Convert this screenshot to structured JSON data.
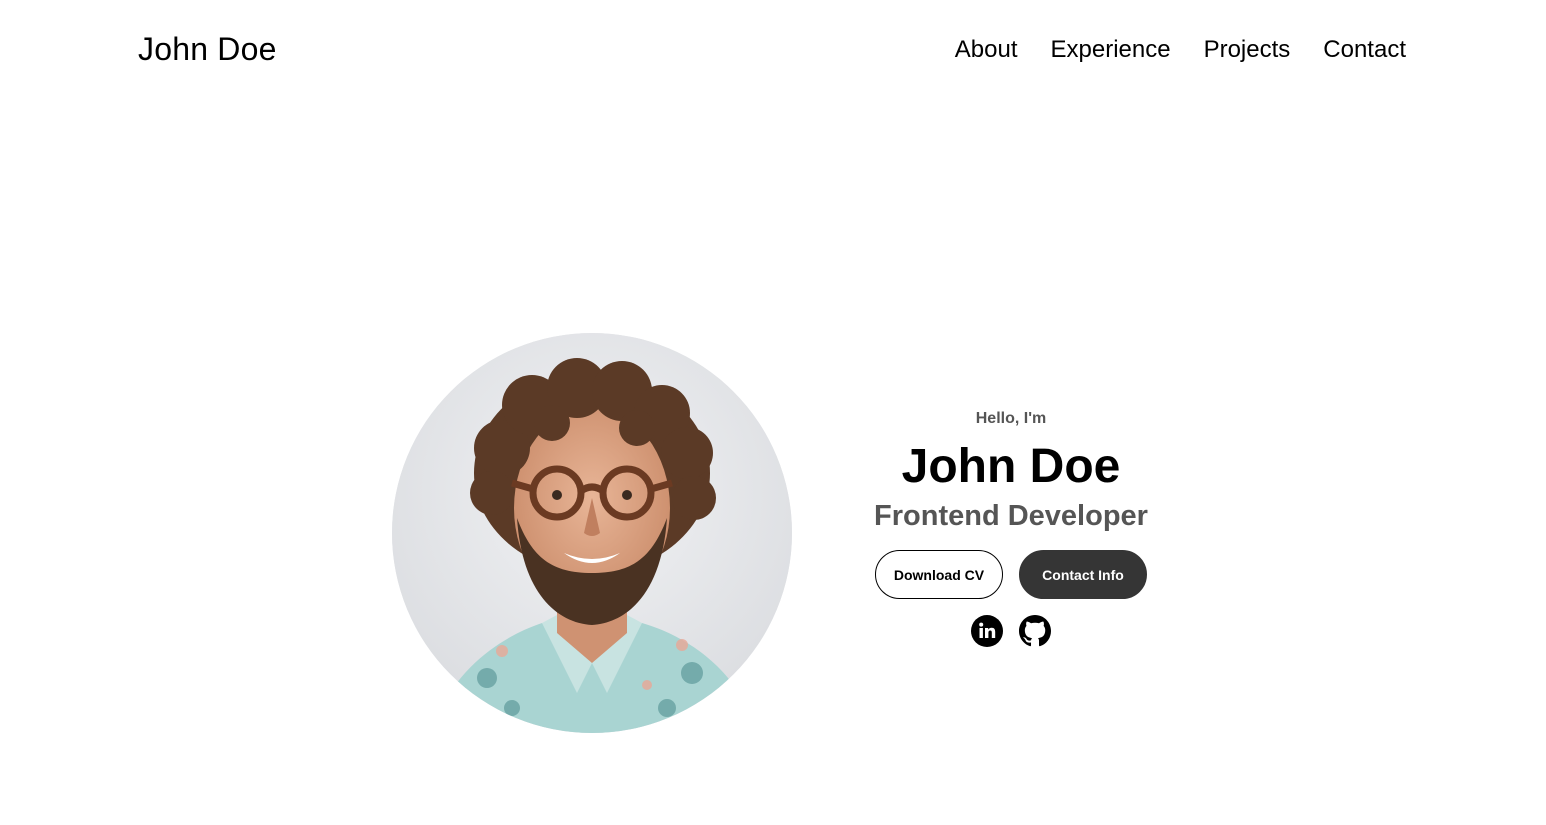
{
  "nav": {
    "logo": "John Doe",
    "links": [
      "About",
      "Experience",
      "Projects",
      "Contact"
    ]
  },
  "hero": {
    "greeting": "Hello, I'm",
    "name": "John Doe",
    "role": "Frontend Developer",
    "buttons": {
      "download_cv": "Download CV",
      "contact_info": "Contact Info"
    },
    "socials": [
      {
        "icon": "linkedin-icon",
        "label": "in"
      },
      {
        "icon": "github-icon"
      }
    ]
  },
  "colors": {
    "text": "#000000",
    "muted": "#555555",
    "button_dark": "#353535",
    "background": "#ffffff"
  }
}
